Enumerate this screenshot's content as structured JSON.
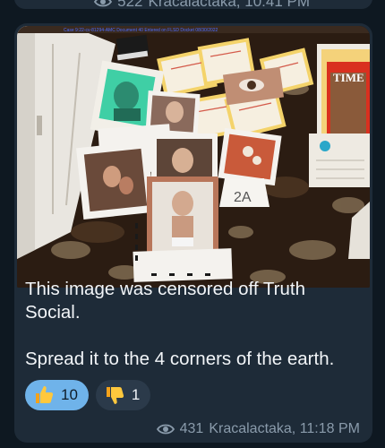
{
  "previous_message": {
    "views": "522",
    "author_time": "Kracalactaka, 10:41 PM"
  },
  "message": {
    "photo_overlay_text": "Case 9:22-cv-81294-AMC    Document 40    Entered on FLSD Docket 08/30/2022",
    "photo_label": "2A",
    "photo_magazine": "TIME",
    "caption_line1": "This image was censored off Truth Social.",
    "caption_line2": "Spread it to the 4 corners of the earth.",
    "reactions": [
      {
        "emoji": "thumbs-up-icon",
        "count": "10",
        "active": true
      },
      {
        "emoji": "thumbs-down-icon",
        "count": "1",
        "active": false
      }
    ],
    "views": "431",
    "author_time": "Kracalactaka, 11:18 PM"
  },
  "colors": {
    "bubble": "#1e2b38",
    "active_reaction": "#6fb3ea",
    "meta_text": "#8a9bab"
  }
}
